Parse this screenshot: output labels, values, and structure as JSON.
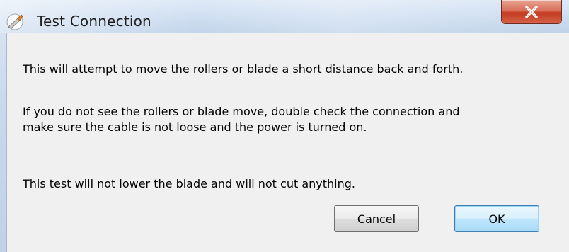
{
  "window": {
    "title": "Test Connection",
    "icon": "knife-icon",
    "close_glyph": "x"
  },
  "message": {
    "line1": "This will attempt to move the rollers or blade a short distance back and forth.",
    "line2a": "If you do not see the rollers or blade move, double check the connection and",
    "line2b": "make sure the cable is not loose and the power is turned on.",
    "line3": "This test will not lower the blade and will not cut anything."
  },
  "buttons": {
    "cancel_label": "Cancel",
    "ok_label": "OK"
  },
  "colors": {
    "close_button": "#c23a1f",
    "ok_button_border": "#3c7fb1",
    "content_background": "#f0f0f0"
  }
}
